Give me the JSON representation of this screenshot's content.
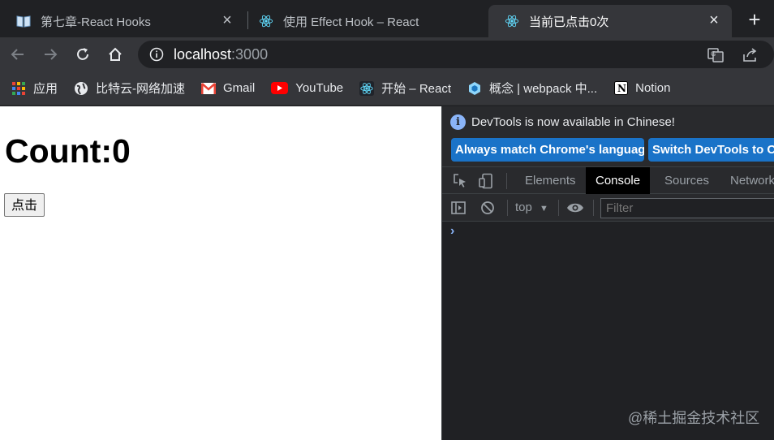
{
  "tabs": [
    {
      "title": "第七章-React Hooks",
      "icon": "book-icon"
    },
    {
      "title": "使用 Effect Hook – React",
      "icon": "react-icon"
    },
    {
      "title": "当前已点击0次",
      "icon": "react-icon",
      "active": true
    }
  ],
  "toolbar": {
    "url_host": "localhost",
    "url_port": ":3000"
  },
  "bookmarks": [
    {
      "label": "应用",
      "icon": "apps-grid-icon"
    },
    {
      "label": "比特云-网络加速",
      "icon": "globe-icon"
    },
    {
      "label": "Gmail",
      "icon": "gmail-icon"
    },
    {
      "label": "YouTube",
      "icon": "youtube-icon"
    },
    {
      "label": "开始 – React",
      "icon": "react-icon"
    },
    {
      "label": "概念 | webpack 中...",
      "icon": "webpack-icon"
    },
    {
      "label": "Notion",
      "icon": "notion-icon"
    }
  ],
  "page": {
    "heading": "Count:0",
    "button_label": "点击"
  },
  "devtools": {
    "notice": "DevTools is now available in Chinese!",
    "btn_match": "Always match Chrome's language",
    "btn_switch": "Switch DevTools to Chinese",
    "tabs": [
      "Elements",
      "Console",
      "Sources",
      "Network"
    ],
    "active_tab": "Console",
    "context": "top",
    "filter_placeholder": "Filter",
    "prompt": "›"
  },
  "watermark": "@稀土掘金技术社区",
  "colors": {
    "accent": "#1a73c8",
    "react": "#61dafb",
    "tab_active": "#35363a",
    "chrome_dark": "#202124"
  }
}
